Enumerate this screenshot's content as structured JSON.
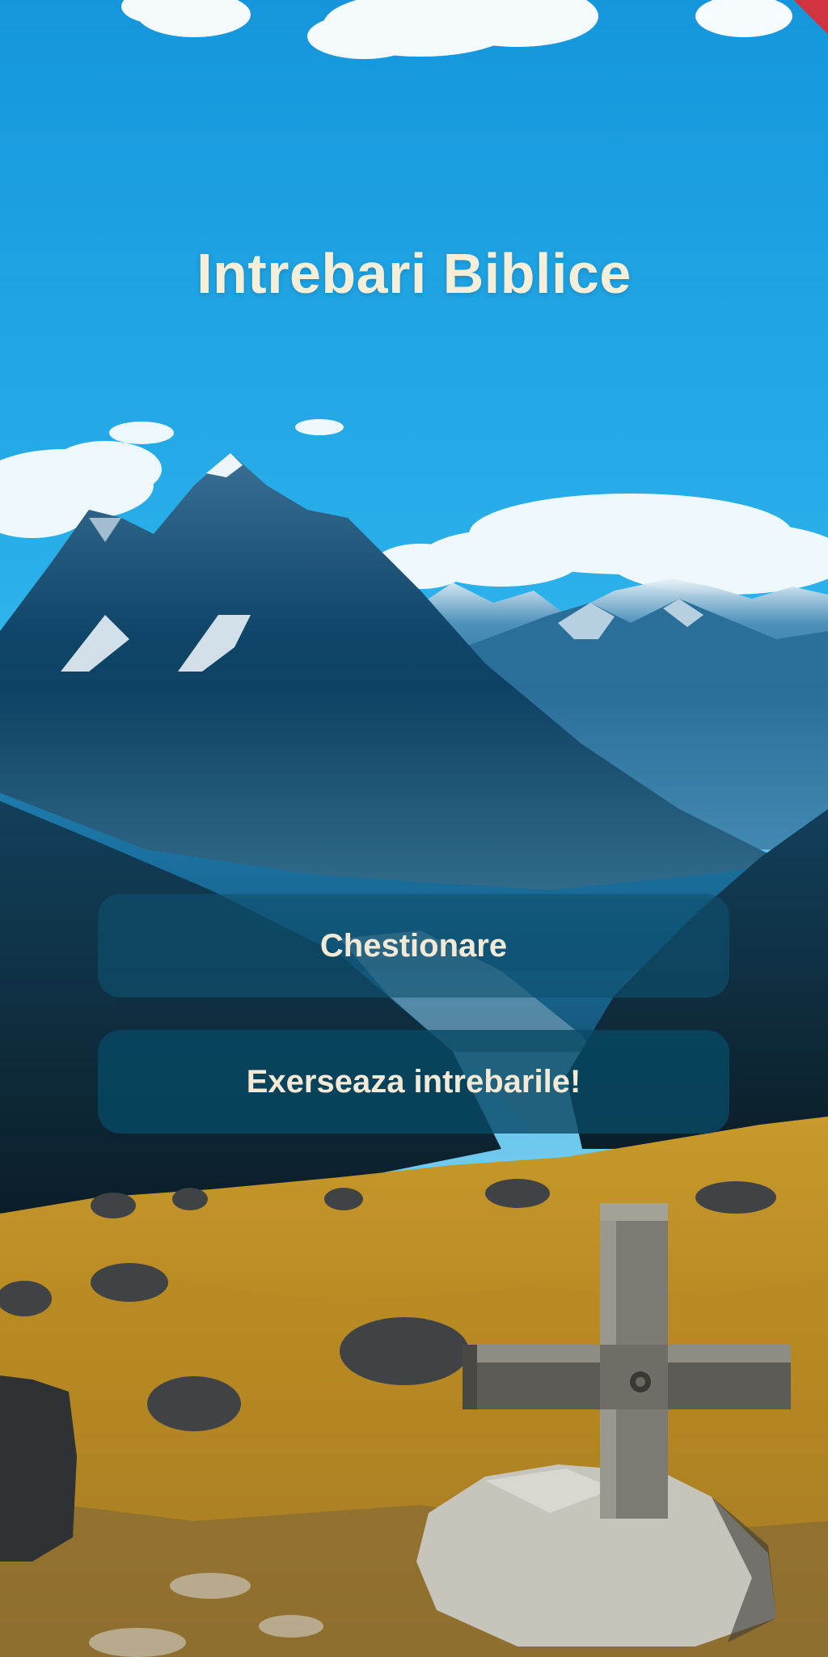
{
  "app": {
    "title": "Intrebari Biblice"
  },
  "menu": {
    "quiz_label": "Chestionare",
    "practice_label": "Exerseaza intrebarile!"
  },
  "background": {
    "description_icon": "mountain-landscape-with-cross",
    "sky_color": "#1aa7e6",
    "grass_color": "#c7962a"
  },
  "colors": {
    "title_text": "#f5efd9",
    "button_text": "#f2ead6",
    "button_background": "#0e5070"
  }
}
